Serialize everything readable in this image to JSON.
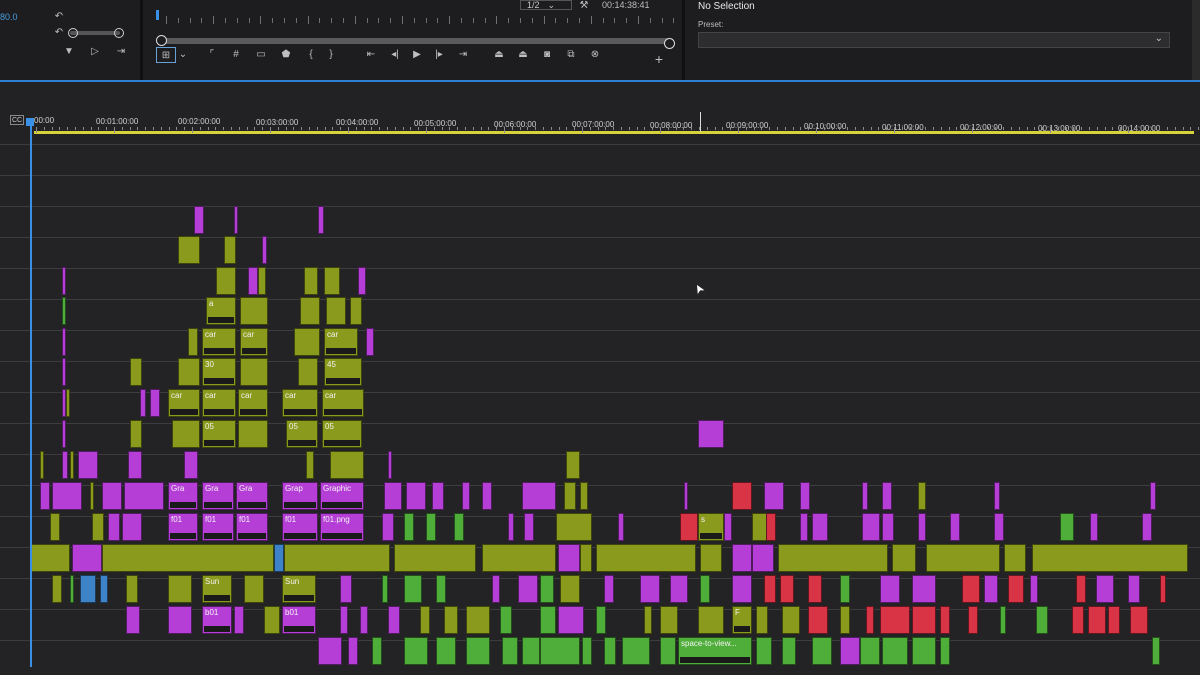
{
  "top_left": {
    "value": "80.0",
    "tools": [
      "undo-icon",
      "undo-icon",
      "undo-icon"
    ]
  },
  "program_monitor": {
    "resolution": "1/2",
    "timecode": "00:14:38:41"
  },
  "effect_controls": {
    "title": "No Selection",
    "preset_label": "Preset:"
  },
  "timeline": {
    "cc_label": "CC",
    "ruler": [
      "00:00",
      "00:01:00:00",
      "00:02:00:00",
      "00:03:00:00",
      "00:04:00:00",
      "00:05:00:00",
      "00:06:00:00",
      "00:07:00:00",
      "00:08:00:00",
      "00:09:00:00",
      "00:10:00:00",
      "00:11:00:00",
      "00:12:00:00",
      "00:13:00:00",
      "00:14:00:00"
    ],
    "clip_labels": {
      "car": "car",
      "n30": "30",
      "n45": "45",
      "n05": "05",
      "gra": "Gra",
      "grap": "Grap",
      "graphic": "Graphic",
      "f01": "f01",
      "f01png": "f01.png",
      "sun": "Sun",
      "b01": "b01",
      "a": "a",
      "s": "s",
      "f": "F",
      "space": "space-to-view..."
    }
  },
  "colors": {
    "olive": "#8a9a1c",
    "magenta": "#b53ed6",
    "green": "#4fae3a",
    "red": "#d83446",
    "blue": "#3e82c8",
    "panel": "#1d1d1f",
    "timeline": "#232325"
  }
}
